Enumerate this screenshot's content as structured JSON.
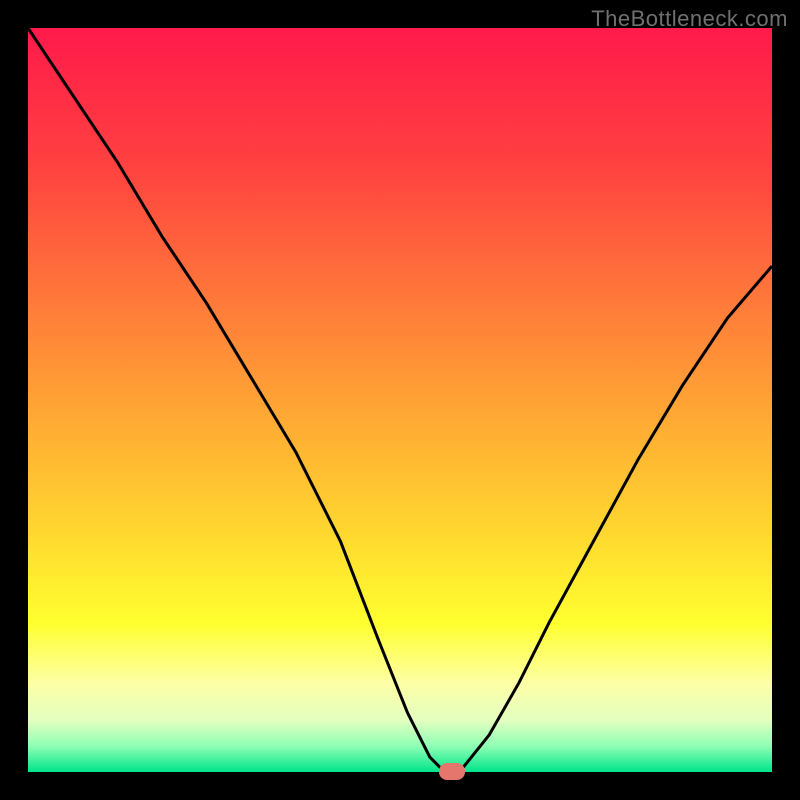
{
  "watermark": "TheBottleneck.com",
  "colors": {
    "frame": "#000000",
    "curve": "#000000",
    "marker": "#e4766e",
    "watermark_text": "#707070",
    "gradient_stops": [
      {
        "offset": 0.0,
        "color": "#ff1a4b"
      },
      {
        "offset": 0.18,
        "color": "#ff4040"
      },
      {
        "offset": 0.36,
        "color": "#ff773a"
      },
      {
        "offset": 0.52,
        "color": "#ffa834"
      },
      {
        "offset": 0.68,
        "color": "#ffd82f"
      },
      {
        "offset": 0.8,
        "color": "#ffff2f"
      },
      {
        "offset": 0.88,
        "color": "#fdffa5"
      },
      {
        "offset": 0.93,
        "color": "#e4ffc0"
      },
      {
        "offset": 0.965,
        "color": "#8fffb4"
      },
      {
        "offset": 1.0,
        "color": "#00e58c"
      }
    ]
  },
  "chart_data": {
    "type": "line",
    "title": "",
    "xlabel": "",
    "ylabel": "",
    "xlim": [
      0,
      100
    ],
    "ylim": [
      0,
      100
    ],
    "x": [
      0,
      6,
      12,
      18,
      24,
      30,
      36,
      42,
      47,
      51,
      54,
      56,
      58,
      62,
      66,
      70,
      76,
      82,
      88,
      94,
      100
    ],
    "values": [
      100,
      91,
      82,
      72,
      63,
      53,
      43,
      31,
      18,
      8,
      2,
      0,
      0,
      5,
      12,
      20,
      31,
      42,
      52,
      61,
      68
    ],
    "minimum_x": 57,
    "minimum_y": 0
  }
}
